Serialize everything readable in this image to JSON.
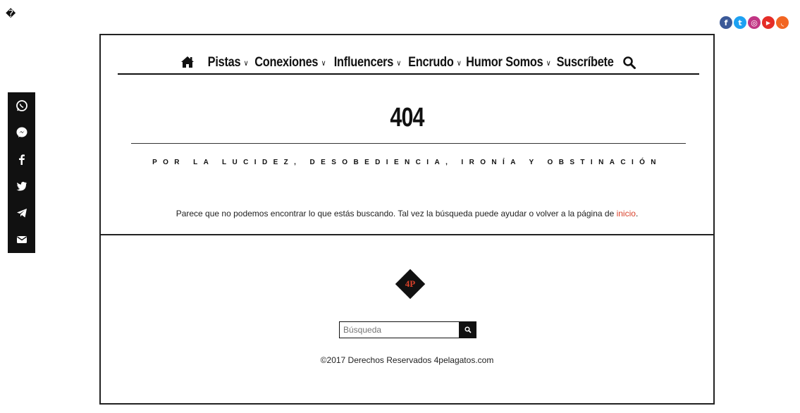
{
  "corner_glyph": "�",
  "social_top": [
    {
      "icon": "facebook-icon",
      "glyph": "f",
      "color": "#3b5998"
    },
    {
      "icon": "twitter-icon",
      "glyph": "t",
      "color": "#1da1f2"
    },
    {
      "icon": "instagram-icon",
      "glyph": "◎",
      "color": "#c13584"
    },
    {
      "icon": "youtube-icon",
      "glyph": "▶",
      "color": "#e52d27"
    },
    {
      "icon": "rss-icon",
      "glyph": "◟",
      "color": "#f26522"
    }
  ],
  "share_bar": [
    {
      "icon": "whatsapp-icon"
    },
    {
      "icon": "messenger-icon"
    },
    {
      "icon": "facebook-icon"
    },
    {
      "icon": "twitter-icon"
    },
    {
      "icon": "telegram-icon"
    },
    {
      "icon": "email-icon"
    }
  ],
  "nav": {
    "home_icon": "home-icon",
    "items": [
      {
        "label": "Pistas",
        "dropdown": true
      },
      {
        "label": "Conexiones",
        "dropdown": true
      },
      {
        "label": "Influencers",
        "dropdown": true
      },
      {
        "label": "Encrudo",
        "dropdown": true
      },
      {
        "label": "Humor",
        "dropdown": false
      },
      {
        "label": "Somos",
        "dropdown": true
      },
      {
        "label": "Suscríbete",
        "dropdown": false
      }
    ],
    "search_icon": "search-icon"
  },
  "page": {
    "title": "404",
    "tagline": "POR LA LUCIDEZ, DESOBEDIENCIA, IRONÍA Y OBSTINACIÓN",
    "not_found_text": "Parece que no podemos encontrar lo que estás buscando. Tal vez la búsqueda puede ayudar o volver a la página de ",
    "home_link": "inicio",
    "not_found_end": "."
  },
  "footer": {
    "logo_text": "4P",
    "search_placeholder": "Búsqueda",
    "copyright": "©2017 Derechos Reservados 4pelagatos.com"
  },
  "colors": {
    "accent_link": "#d9412a",
    "ink": "#111111"
  }
}
